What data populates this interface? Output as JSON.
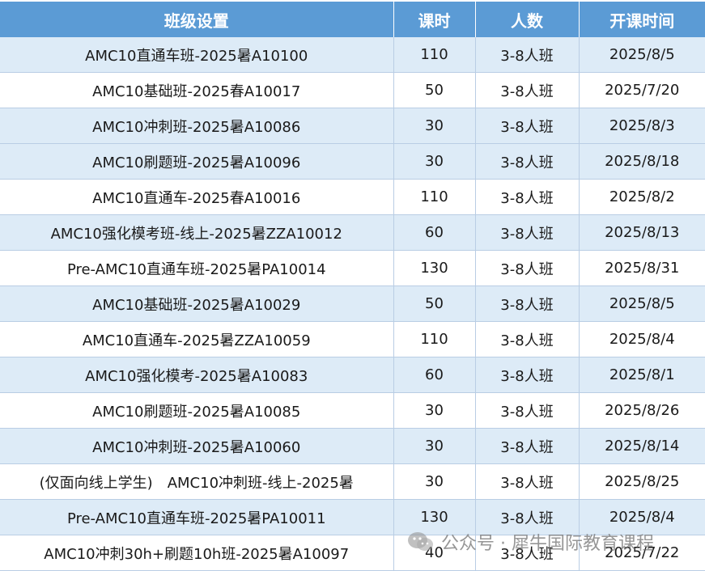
{
  "table": {
    "headers": [
      "班级设置",
      "课时",
      "人数",
      "开课时间"
    ],
    "rows": [
      [
        "AMC10直通车班-2025暑A10100",
        "110",
        "3-8人班",
        "2025/8/5"
      ],
      [
        "AMC10基础班-2025春A10017",
        "50",
        "3-8人班",
        "2025/7/20"
      ],
      [
        "AMC10冲刺班-2025暑A10086",
        "30",
        "3-8人班",
        "2025/8/3"
      ],
      [
        "AMC10刷题班-2025暑A10096",
        "30",
        "3-8人班",
        "2025/8/18"
      ],
      [
        "AMC10直通车-2025春A10016",
        "110",
        "3-8人班",
        "2025/8/2"
      ],
      [
        "AMC10强化模考班-线上-2025暑ZZA10012",
        "60",
        "3-8人班",
        "2025/8/13"
      ],
      [
        "Pre-AMC10直通车班-2025暑PA10014",
        "130",
        "3-8人班",
        "2025/8/31"
      ],
      [
        "AMC10基础班-2025暑A10029",
        "50",
        "3-8人班",
        "2025/8/5"
      ],
      [
        "AMC10直通车-2025暑ZZA10059",
        "110",
        "3-8人班",
        "2025/8/4"
      ],
      [
        "AMC10强化模考-2025暑A10083",
        "60",
        "3-8人班",
        "2025/8/1"
      ],
      [
        "AMC10刷题班-2025暑A10085",
        "30",
        "3-8人班",
        "2025/8/26"
      ],
      [
        "AMC10冲刺班-2025暑A10060",
        "30",
        "3-8人班",
        "2025/8/14"
      ],
      [
        "(仅面向线上学生)　AMC10冲刺班-线上-2025暑",
        "30",
        "3-8人班",
        "2025/8/25"
      ],
      [
        "Pre-AMC10直通车班-2025暑PA10011",
        "130",
        "3-8人班",
        "2025/8/4"
      ],
      [
        "AMC10冲刺30h+刷题10h班-2025暑A10097",
        "40",
        "3-8人班",
        "2025/7/22"
      ]
    ]
  },
  "watermark": {
    "text": "公众号 · 犀牛国际教育课程",
    "icon": "wechat-icon"
  },
  "colors": {
    "header_bg": "#5b9bd5",
    "header_text": "#ffffff",
    "band_row_bg": "#ddebf7",
    "plain_row_bg": "#ffffff",
    "grid_line": "#b9cde4"
  }
}
